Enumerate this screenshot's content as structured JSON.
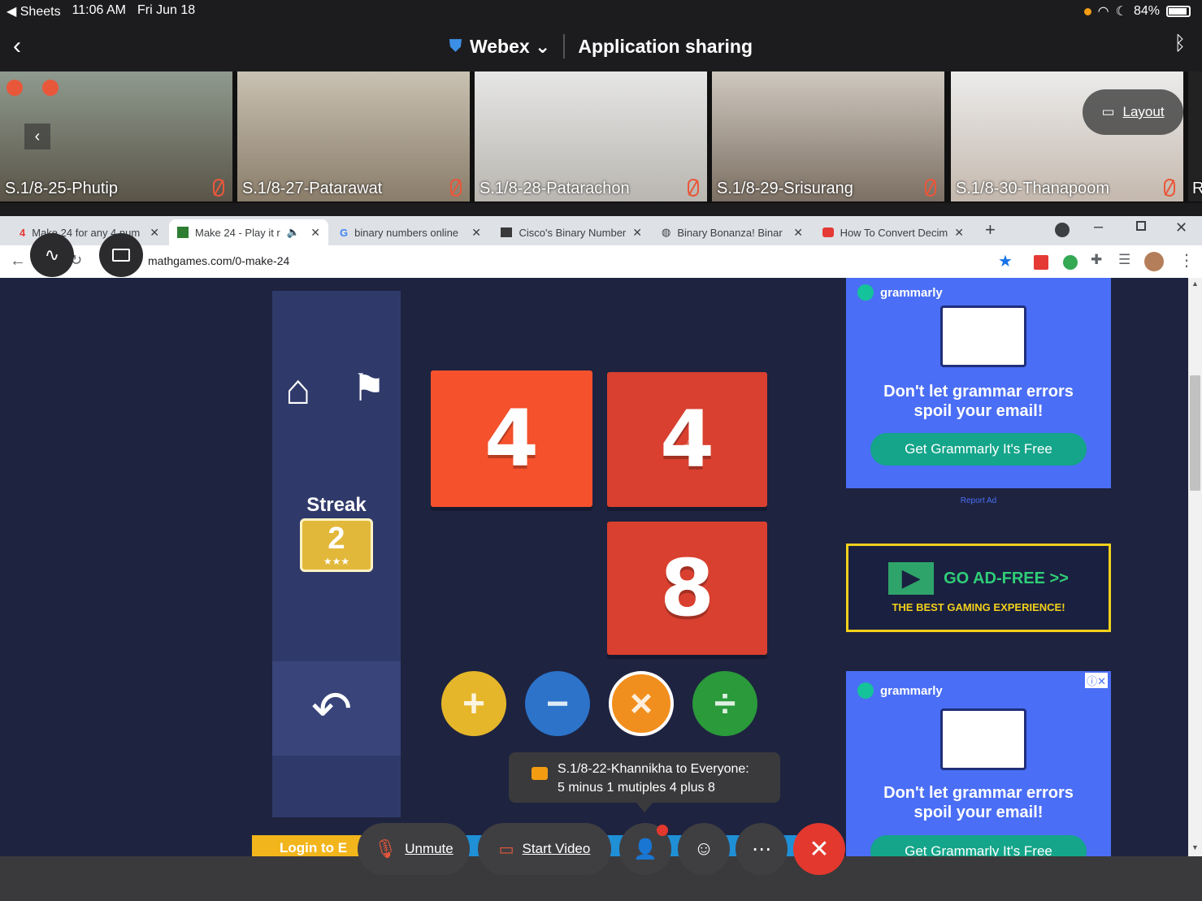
{
  "status_bar": {
    "app": "Sheets",
    "time": "11:06 AM",
    "date": "Fri Jun 18",
    "battery": "84%"
  },
  "header": {
    "app": "Webex",
    "title": "Application sharing"
  },
  "participants": [
    {
      "name": "S.1/8-25-Phutip"
    },
    {
      "name": "S.1/8-27-Patarawat"
    },
    {
      "name": "S.1/8-28-Patarachon"
    },
    {
      "name": "S.1/8-29-Srisurang"
    },
    {
      "name": "S.1/8-30-Thanapoom"
    }
  ],
  "partial_participant": "R",
  "layout_label": "Layout",
  "browser": {
    "tabs": [
      {
        "label": "Make 24 for any 4 num"
      },
      {
        "label": "Make 24 - Play it r"
      },
      {
        "label": "binary numbers online"
      },
      {
        "label": "Cisco's Binary Number"
      },
      {
        "label": "Binary Bonanza! Binar"
      },
      {
        "label": "How To Convert Decim"
      }
    ],
    "url": "mathgames.com/0-make-24"
  },
  "game": {
    "streak_label": "Streak",
    "streak_value": "2",
    "cards": [
      "4",
      "4",
      "8"
    ],
    "ops": [
      "+",
      "−",
      "×",
      "÷"
    ],
    "login_label": "Login to E"
  },
  "ads": {
    "brand": "grammarly",
    "message_line1": "Don't let grammar errors",
    "message_line2": "spoil your email!",
    "cta": "Get Grammarly  It's Free",
    "report": "Report Ad",
    "adfree_title": "GO AD-FREE >>",
    "adfree_sub": "THE BEST GAMING EXPERIENCE!"
  },
  "chat": {
    "sender": "S.1/8-22-Khannikha to Everyone:",
    "message": "5 minus 1 mutiples 4 plus 8"
  },
  "controls": {
    "unmute": "Unmute",
    "start_video": "Start Video"
  },
  "colors": {
    "card_orange": "#f4512c",
    "card_red": "#d9402f",
    "plus": "#e5b62a",
    "minus": "#2c73c9",
    "times": "#f18f1e",
    "divide": "#2a9a3a",
    "end": "#e2382e"
  }
}
